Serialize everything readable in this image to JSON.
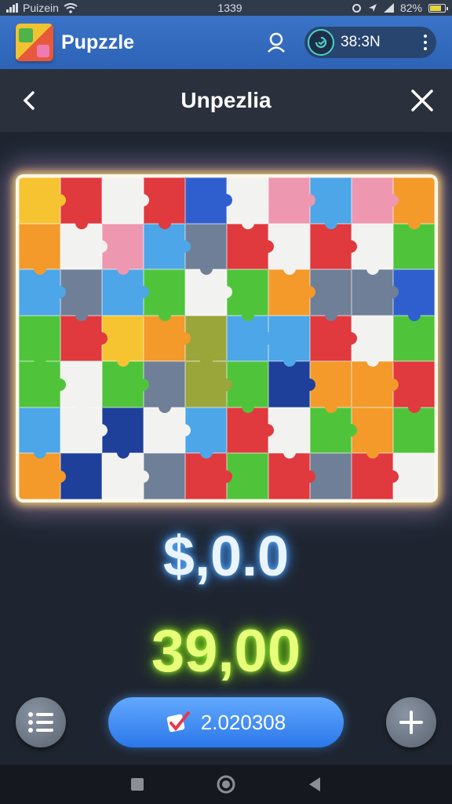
{
  "status_bar": {
    "carrier": "Puizein",
    "time": "1339",
    "battery": "82%",
    "battery_level": 0.82
  },
  "app_bar": {
    "title": "Pupzzle",
    "timer": "38:3N",
    "icons": [
      "app-logo",
      "search-icon",
      "timer-icon",
      "more-vertical-icon"
    ]
  },
  "nav": {
    "title": "Unpezlia",
    "back_icon": "chevron-left-icon",
    "close_icon": "close-icon"
  },
  "board": {
    "columns": 10,
    "rows": 7,
    "palette": {
      "Y": "#f6c431",
      "R": "#e0393e",
      "W": "#f2f2f0",
      "B": "#2f5fcf",
      "P": "#ee97b0",
      "L": "#4ca6e8",
      "G": "#4fc43a",
      "O": "#f39a2b",
      "S": "#6f7f97",
      "K": "#9aa53a",
      "D": "#1e3f9a"
    },
    "grid": [
      "YRWRBWPLPO",
      "OWPLSRWRWG",
      "LSLGWGOSSB",
      "GRYOKLLRWG",
      "GWGSKGDOOR",
      "LWDWLRWGOG",
      "ODWSRGRSRW"
    ]
  },
  "scores": {
    "primary": "$,0.0",
    "secondary": "39,00"
  },
  "controls": {
    "list_icon": "list-icon",
    "main_label": "2.020308",
    "main_icon": "checkmark-icon",
    "plus_icon": "plus-icon"
  },
  "system_nav": [
    "square-icon",
    "home-icon",
    "back-triangle-icon"
  ]
}
